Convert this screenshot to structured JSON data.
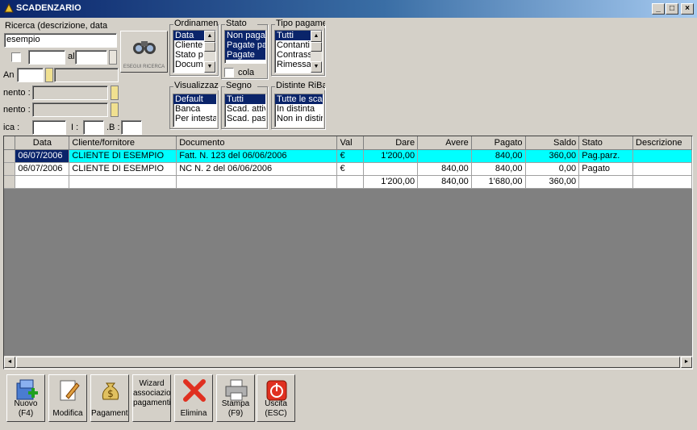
{
  "window": {
    "title": "SCADENZARIO"
  },
  "search": {
    "label": "Ricerca (descrizione, data",
    "value": "esempio",
    "al_label": "al",
    "anno_label": "An",
    "field1_label": "nento :",
    "field2_label": "nento :",
    "ica_label": "ica :",
    "i_label": "I :",
    "b_label": ".B :",
    "button_label": "ESEGUI RICERCA"
  },
  "ordinamento": {
    "title": "Ordinamen",
    "items": [
      "Data",
      "Cliente",
      "Stato p",
      "Docum"
    ]
  },
  "stato": {
    "title": "Stato",
    "items": [
      "Non paga",
      "Pagate pa",
      "Pagate"
    ],
    "checkbox_label": "cola"
  },
  "tipo_pagamento": {
    "title": "Tipo pagame",
    "items": [
      "Tutti",
      "Contanti",
      "Contrass",
      "Rimessa"
    ]
  },
  "visualizzazione": {
    "title": "Visualizzaz",
    "items": [
      "Default",
      "Banca",
      "Per intesta"
    ]
  },
  "segno": {
    "title": "Segno",
    "items": [
      "Tutti",
      "Scad. attiv",
      "Scad. pas"
    ]
  },
  "distinte": {
    "title": "Distinte RiBa",
    "items": [
      "Tutte le sca",
      "In distinta",
      "Non in distir"
    ]
  },
  "grid": {
    "columns": [
      "Data",
      "Cliente/fornitore",
      "Documento",
      "Val",
      "Dare",
      "Avere",
      "Pagato",
      "Saldo",
      "Stato",
      "Descrizione"
    ],
    "rows": [
      [
        "06/07/2006",
        "CLIENTE DI ESEMPIO",
        "Fatt. N. 123 del 06/06/2006",
        "€",
        "1'200,00",
        "",
        "840,00",
        "360,00",
        "Pag.parz.",
        ""
      ],
      [
        "06/07/2006",
        "CLIENTE DI ESEMPIO",
        "NC N. 2 del 06/06/2006",
        "€",
        "",
        "840,00",
        "840,00",
        "0,00",
        "Pagato",
        ""
      ],
      [
        "",
        "",
        "",
        "",
        "1'200,00",
        "840,00",
        "1'680,00",
        "360,00",
        "",
        ""
      ]
    ]
  },
  "toolbar": {
    "nuovo": "Nuovo\n(F4)",
    "modifica": "Modifica",
    "pagamenti": "Pagamenti",
    "wizard": "Wizard\nassociazion\npagamenti",
    "elimina": "Elimina",
    "stampa": "Stampa\n(F9)",
    "uscita": "Uscita\n(ESC)"
  },
  "colors": {
    "titlebar": "#0a246a",
    "highlight_row": "#00ffff",
    "selection": "#0a246a"
  }
}
